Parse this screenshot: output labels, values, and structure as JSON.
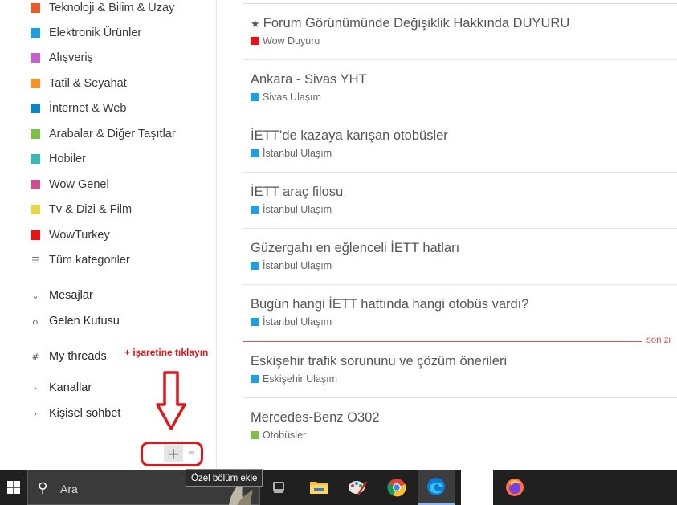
{
  "categories": [
    {
      "label": "Teknoloji & Bilim & Uzay",
      "color": "#e95b28"
    },
    {
      "label": "Elektronik Ürünler",
      "color": "#1ba1e2"
    },
    {
      "label": "Alışveriş",
      "color": "#c45fd0"
    },
    {
      "label": "Tatil & Seyahat",
      "color": "#f6922b"
    },
    {
      "label": "İnternet & Web",
      "color": "#0f81c7"
    },
    {
      "label": "Arabalar & Diğer Taşıtlar",
      "color": "#7cbf46"
    },
    {
      "label": "Hobiler",
      "color": "#3bb7b4"
    },
    {
      "label": "Wow Genel",
      "color": "#cf4f8c"
    },
    {
      "label": "Tv & Dizi & Film",
      "color": "#e8d44d"
    },
    {
      "label": "WowTurkey",
      "color": "#ee1111"
    }
  ],
  "sidebar": {
    "all_categories": "Tüm kategoriler",
    "messages": "Mesajlar",
    "inbox": "Gelen Kutusu",
    "my_threads": "My threads",
    "channels": "Kanallar",
    "personal_chat": "Kişisel sohbet",
    "annotation": "+ işaretine tıklayın",
    "tooltip": "Özel bölüm ekle"
  },
  "threads": [
    {
      "title": "Forum Görünümünde Değişiklik Hakkında DUYURU",
      "pinned": true,
      "tag": "Wow Duyuru",
      "tag_color": "#ee1111"
    },
    {
      "title": "Ankara - Sivas YHT",
      "pinned": false,
      "tag": "Sivas Ulaşım",
      "tag_color": "#1ba1e2"
    },
    {
      "title": "İETT’de kazaya karışan otobüsler",
      "pinned": false,
      "tag": "İstanbul Ulaşım",
      "tag_color": "#1ba1e2"
    },
    {
      "title": "İETT araç filosu",
      "pinned": false,
      "tag": "İstanbul Ulaşım",
      "tag_color": "#1ba1e2"
    },
    {
      "title": "Güzergahı en eğlenceli İETT hatları",
      "pinned": false,
      "tag": "İstanbul Ulaşım",
      "tag_color": "#1ba1e2"
    },
    {
      "title": "Bugün hangi İETT hattında hangi otobüs vardı?",
      "pinned": false,
      "tag": "İstanbul Ulaşım",
      "tag_color": "#1ba1e2"
    },
    {
      "title": "Eskişehir trafik sorununu ve çözüm önerileri",
      "pinned": false,
      "tag": "Eskişehir Ulaşım",
      "tag_color": "#1ba1e2"
    },
    {
      "title": "Mercedes-Benz O302",
      "pinned": false,
      "tag": "Otobüsler",
      "tag_color": "#7cbf46"
    }
  ],
  "divider_label": "son zi",
  "taskbar": {
    "search_placeholder": "Ara",
    "apps": [
      "task-view",
      "file-explorer",
      "paint",
      "chrome",
      "edge",
      "blank-app",
      "firefox"
    ]
  }
}
